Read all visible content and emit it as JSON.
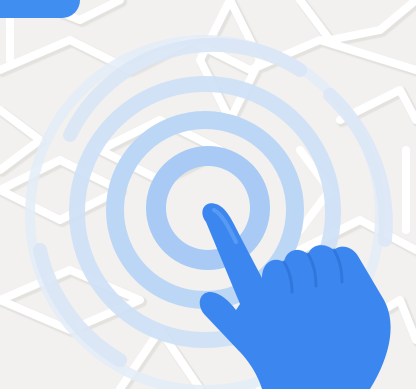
{
  "colors": {
    "background": "#f2f1ef",
    "pattern_line": "#ffffff",
    "pattern_shadow": "#e2e1de",
    "ring_faint": "#dfe9f6",
    "ring_light": "#cfe0f7",
    "ring_mid": "#bcd5f6",
    "ring_inner": "#a9cbf5",
    "hand_fill": "#3b86ee",
    "hand_shade": "#2c6fd6",
    "accent": "#3f8ef0"
  },
  "icons": {
    "tap": "tap-gesture-icon",
    "ripple": "ripple-rings-icon",
    "corner": "corner-pill"
  }
}
